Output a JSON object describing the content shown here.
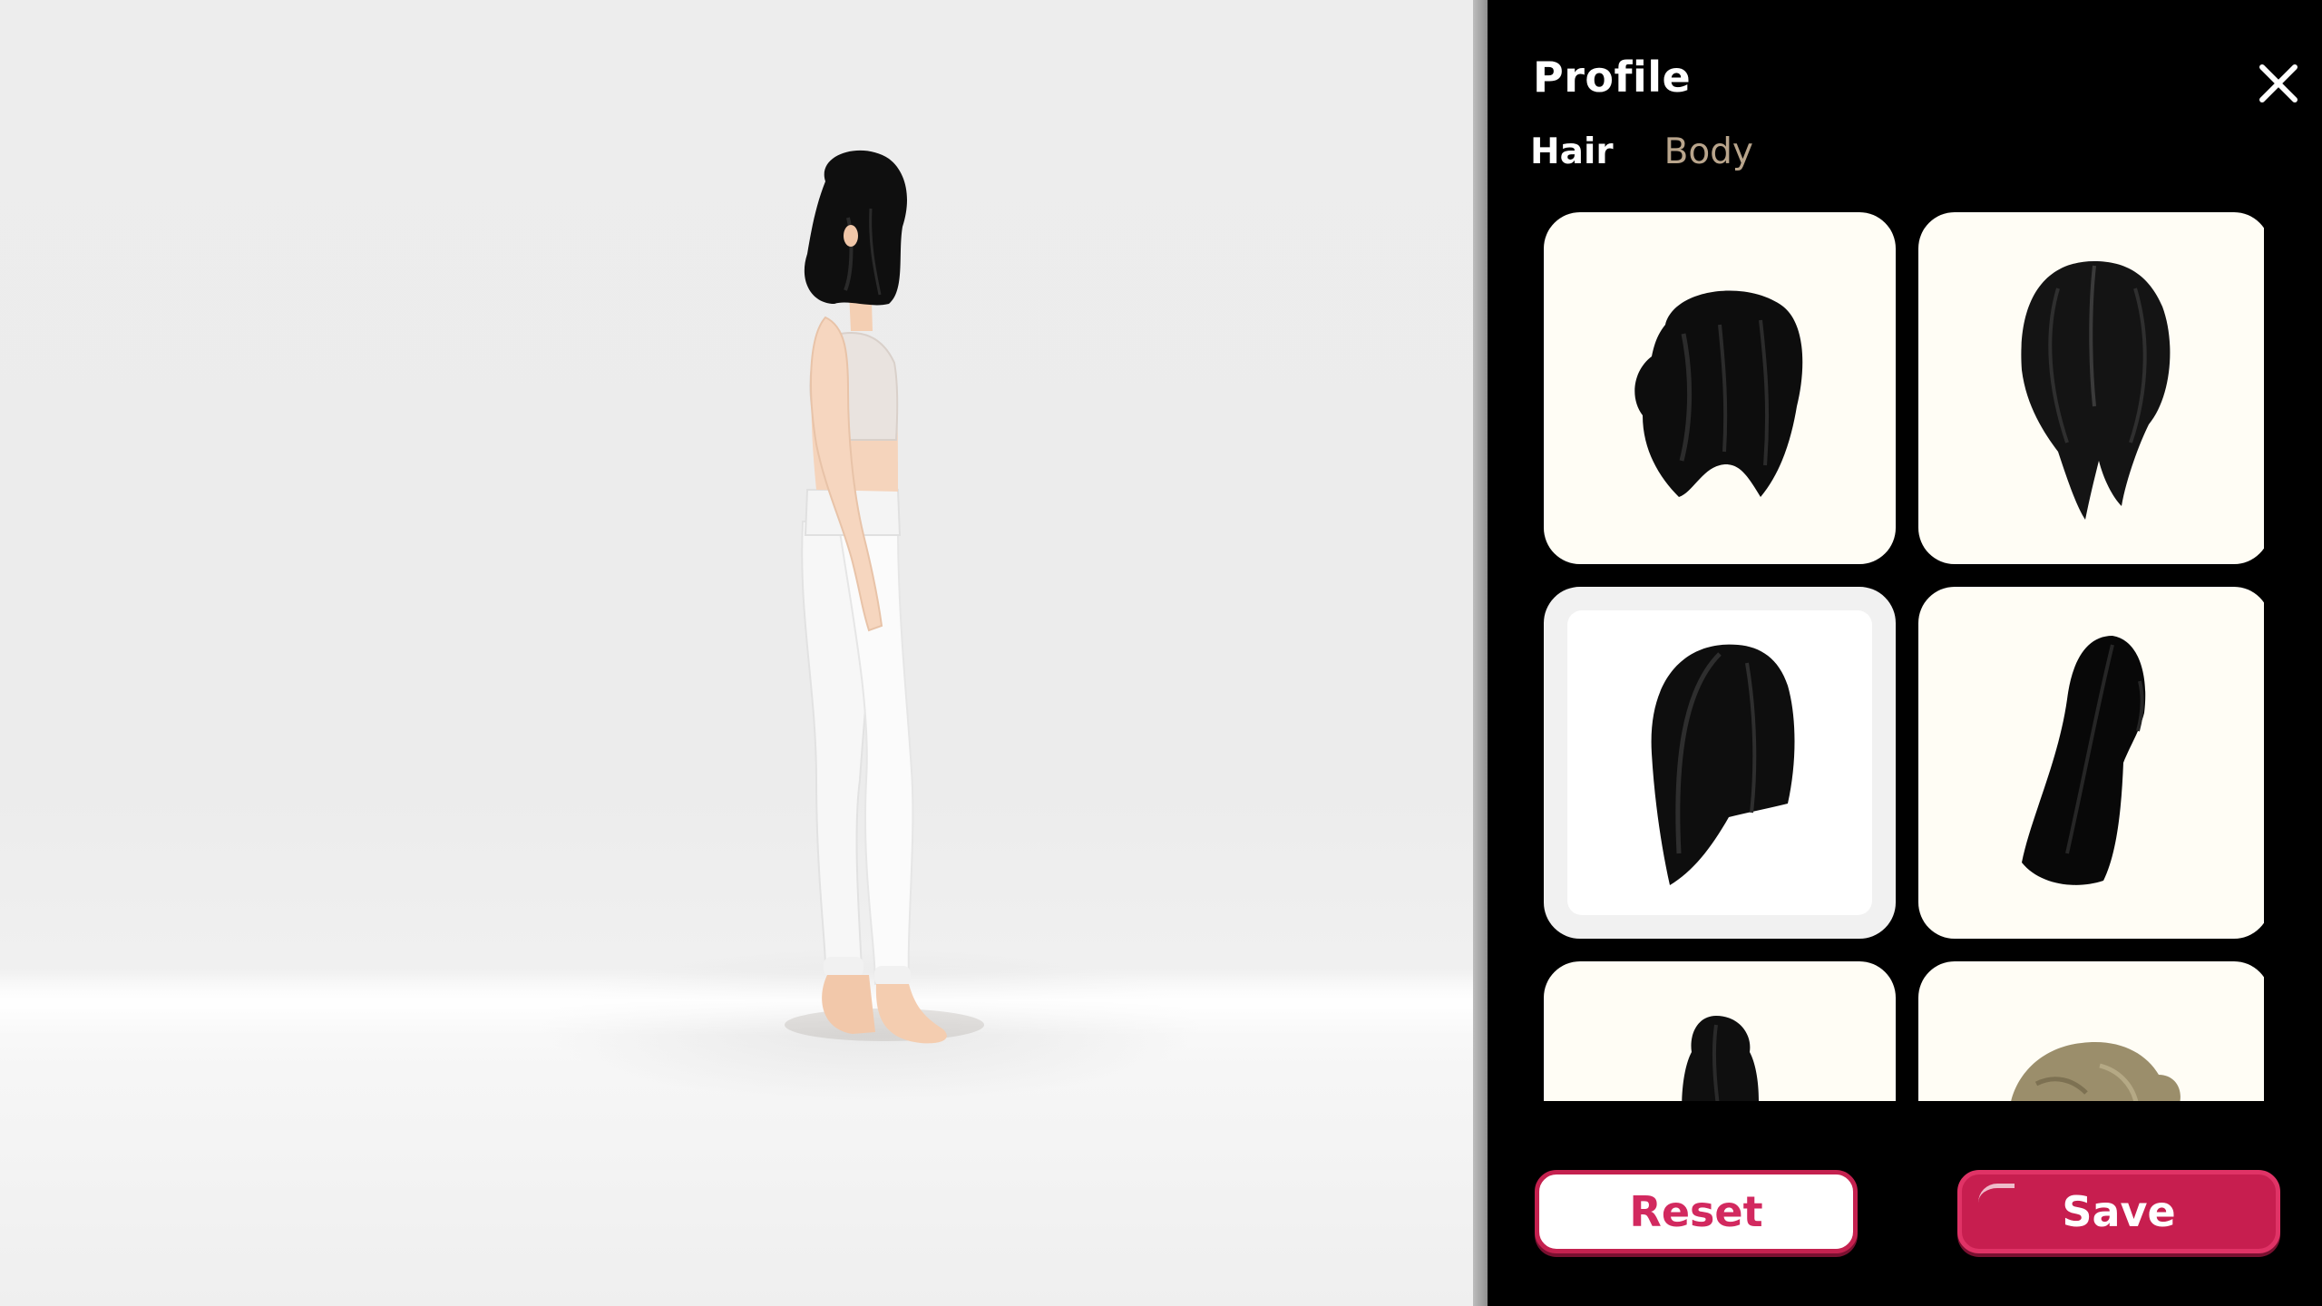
{
  "panel": {
    "title": "Profile",
    "close_icon": "close-icon"
  },
  "tabs": [
    {
      "label": "Hair",
      "active": true
    },
    {
      "label": "Body",
      "active": false
    }
  ],
  "hair_options": [
    {
      "style": "short-bob-with-bangs",
      "color": "#111111",
      "selected": false
    },
    {
      "style": "center-part-long",
      "color": "#1a1a1a",
      "selected": false
    },
    {
      "style": "side-swept-lob",
      "color": "#111111",
      "selected": true
    },
    {
      "style": "long-straight-side-part",
      "color": "#0c0c0c",
      "selected": false
    },
    {
      "style": "high-bun",
      "color": "#111111",
      "selected": false
    },
    {
      "style": "wavy-blonde",
      "color": "#9c8f6c",
      "selected": false
    }
  ],
  "actions": {
    "reset_label": "Reset",
    "save_label": "Save"
  },
  "colors": {
    "accent": "#c71e4f",
    "tab_inactive": "#b9a58c",
    "card_bg": "#fffdf5"
  }
}
